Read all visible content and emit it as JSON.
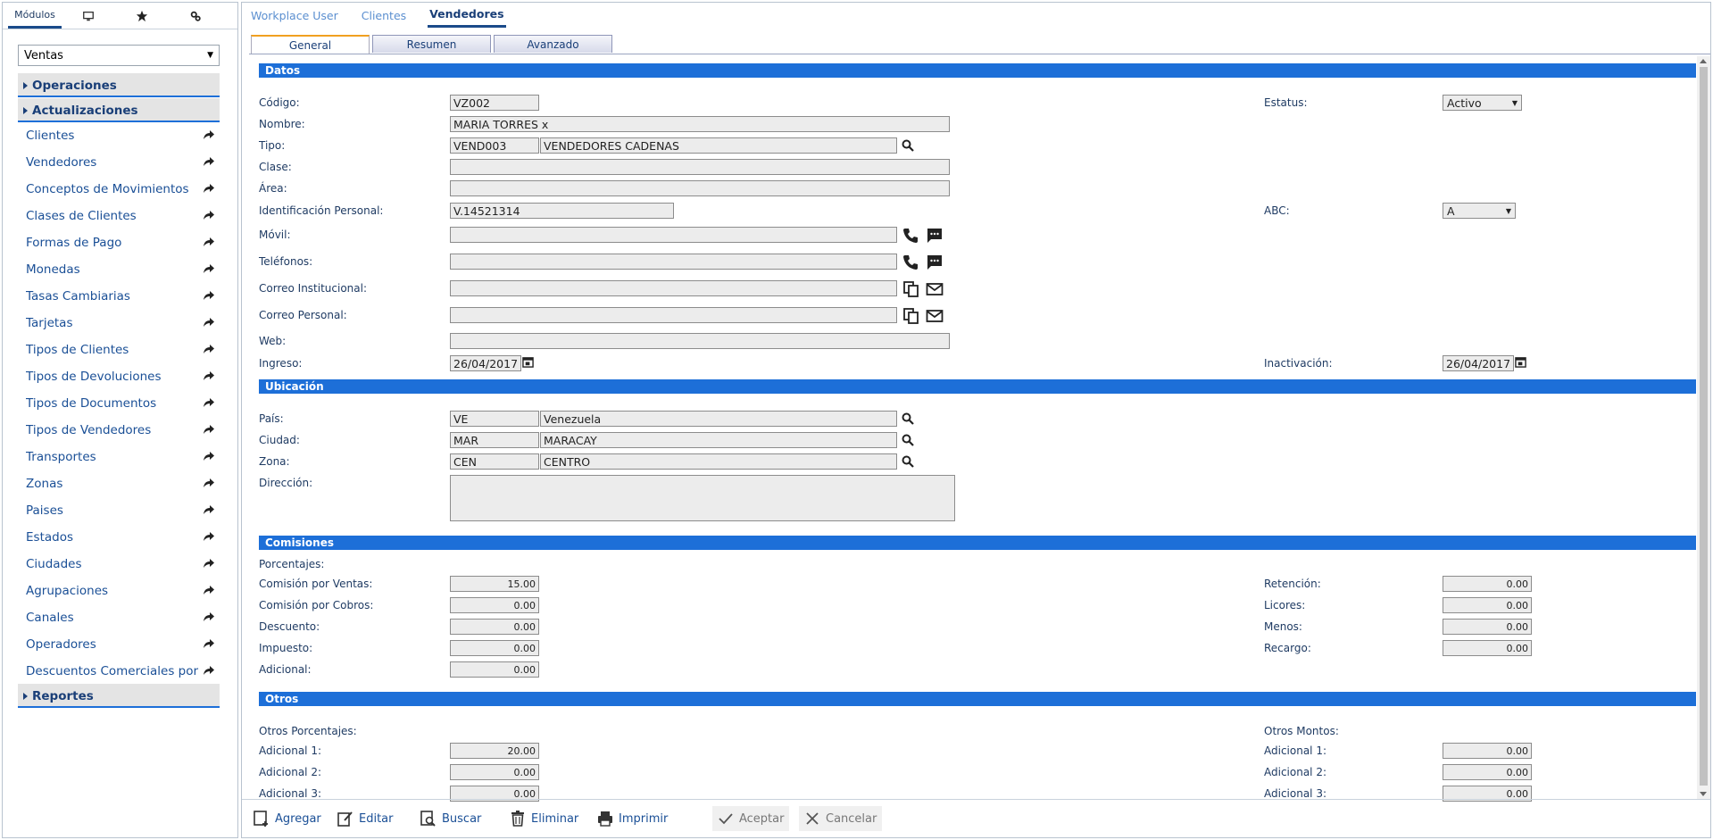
{
  "sidebar": {
    "tabs": [
      {
        "label": "Módulos",
        "icon": ""
      },
      {
        "label": "",
        "icon": "monitor-icon"
      },
      {
        "label": "",
        "icon": "star-icon"
      },
      {
        "label": "",
        "icon": "settings-icon"
      }
    ],
    "module_select": "Ventas",
    "sections": {
      "operaciones": "Operaciones",
      "actualizaciones": "Actualizaciones",
      "reportes": "Reportes"
    },
    "items": [
      "Clientes",
      "Vendedores",
      "Conceptos de Movimientos",
      "Clases de Clientes",
      "Formas de Pago",
      "Monedas",
      "Tasas Cambiarias",
      "Tarjetas",
      "Tipos de Clientes",
      "Tipos de Devoluciones",
      "Tipos de Documentos",
      "Tipos de Vendedores",
      "Transportes",
      "Zonas",
      "Paises",
      "Estados",
      "Ciudades",
      "Agrupaciones",
      "Canales",
      "Operadores",
      "Descuentos Comerciales por Volumen"
    ],
    "selected_item": "Vendedores"
  },
  "top_tabs": [
    "Workplace User",
    "Clientes",
    "Vendedores"
  ],
  "active_top_tab": "Vendedores",
  "sub_tabs": [
    "General",
    "Resumen",
    "Avanzado"
  ],
  "active_sub_tab": "General",
  "sections": {
    "datos": "Datos",
    "ubicacion": "Ubicación",
    "comisiones": "Comisiones",
    "otros": "Otros"
  },
  "datos": {
    "codigo_label": "Código:",
    "codigo": "VZ002",
    "nombre_label": "Nombre:",
    "nombre": "MARIA TORRES x",
    "tipo_label": "Tipo:",
    "tipo_code": "VEND003",
    "tipo_desc": "VENDEDORES CADENAS",
    "clase_label": "Clase:",
    "clase": "",
    "area_label": "Área:",
    "area": "",
    "id_label": "Identificación Personal:",
    "id": "V.14521314",
    "movil_label": "Móvil:",
    "movil": "",
    "telefonos_label": "Teléfonos:",
    "telefonos": "",
    "correo_inst_label": "Correo Institucional:",
    "correo_inst": "",
    "correo_pers_label": "Correo Personal:",
    "correo_pers": "",
    "web_label": "Web:",
    "web": "",
    "ingreso_label": "Ingreso:",
    "ingreso": "26/04/2017",
    "estatus_label": "Estatus:",
    "estatus": "Activo",
    "abc_label": "ABC:",
    "abc": "A",
    "inactivacion_label": "Inactivación:",
    "inactivacion": "26/04/2017"
  },
  "ubicacion": {
    "pais_label": "País:",
    "pais_code": "VE",
    "pais_desc": "Venezuela",
    "ciudad_label": "Ciudad:",
    "ciudad_code": "MAR",
    "ciudad_desc": "MARACAY",
    "zona_label": "Zona:",
    "zona_code": "CEN",
    "zona_desc": "CENTRO",
    "direccion_label": "Dirección:",
    "direccion": ""
  },
  "comisiones": {
    "porcentajes_label": "Porcentajes:",
    "left": [
      {
        "label": "Comisión por Ventas:",
        "value": "15.00"
      },
      {
        "label": "Comisión por Cobros:",
        "value": "0.00"
      },
      {
        "label": "Descuento:",
        "value": "0.00"
      },
      {
        "label": "Impuesto:",
        "value": "0.00"
      },
      {
        "label": "Adicional:",
        "value": "0.00"
      }
    ],
    "right": [
      {
        "label": "Retención:",
        "value": "0.00"
      },
      {
        "label": "Licores:",
        "value": "0.00"
      },
      {
        "label": "Menos:",
        "value": "0.00"
      },
      {
        "label": "Recargo:",
        "value": "0.00"
      }
    ]
  },
  "otros": {
    "porcentajes_label": "Otros Porcentajes:",
    "montos_label": "Otros Montos:",
    "left": [
      {
        "label": "Adicional 1:",
        "value": "20.00"
      },
      {
        "label": "Adicional 2:",
        "value": "0.00"
      },
      {
        "label": "Adicional 3:",
        "value": "0.00"
      }
    ],
    "right": [
      {
        "label": "Adicional 1:",
        "value": "0.00"
      },
      {
        "label": "Adicional 2:",
        "value": "0.00"
      },
      {
        "label": "Adicional 3:",
        "value": "0.00"
      }
    ]
  },
  "toolbar": {
    "agregar": "Agregar",
    "editar": "Editar",
    "buscar": "Buscar",
    "eliminar": "Eliminar",
    "imprimir": "Imprimir",
    "aceptar": "Aceptar",
    "cancelar": "Cancelar"
  },
  "colors": {
    "accent": "#1d6fd8",
    "tab_active": "#f0a020",
    "text": "#1f3b63"
  }
}
